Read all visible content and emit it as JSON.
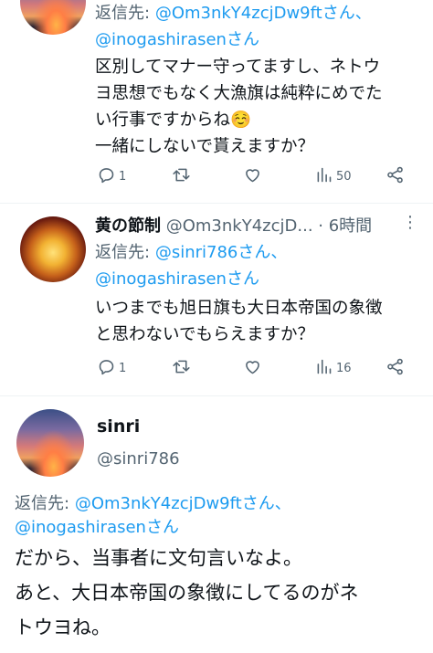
{
  "tweet1": {
    "reply_prefix": "返信先:",
    "mention1": "@Om3nkY4zcjDw9ftさん、",
    "mention2": "@inogashirasenさん",
    "body": [
      "区別してマナー守ってますし、ネトウ",
      "ヨ思想でもなく大漁旗は純粋にめでた",
      "い行事ですからね☺️",
      "一緒にしないで貰えますか？"
    ],
    "replies": "1",
    "retweets": "",
    "likes": "",
    "views": "50"
  },
  "tweet2": {
    "display_name": "黄の節制",
    "handle_time": "@Om3nkY4zcjD... · 6時間",
    "reply_prefix": "返信先:",
    "mention1": "@sinri786さん、",
    "mention2": "@inogashirasenさん",
    "body": [
      "いつまでも旭日旗も大日本帝国の象徴",
      "と思わないでもらえますか？"
    ],
    "replies": "1",
    "retweets": "",
    "likes": "",
    "views": "16"
  },
  "tweet3": {
    "display_name": "sinri",
    "handle": "@sinri786",
    "reply_prefix": "返信先:",
    "mention1": "@Om3nkY4zcjDw9ftさん、",
    "mention2": "@inogashirasenさん",
    "body": [
      "だから、当事者に文句言いなよ。",
      "あと、大日本帝国の象徴にしてるのがネ",
      "トウヨね。"
    ]
  },
  "icons": [
    "reply-icon",
    "retweet-icon",
    "like-icon",
    "views-icon",
    "share-icon",
    "more-icon"
  ],
  "colors": {
    "link": "#1d9bf0",
    "secondary": "#536471",
    "text": "#0f1419"
  }
}
